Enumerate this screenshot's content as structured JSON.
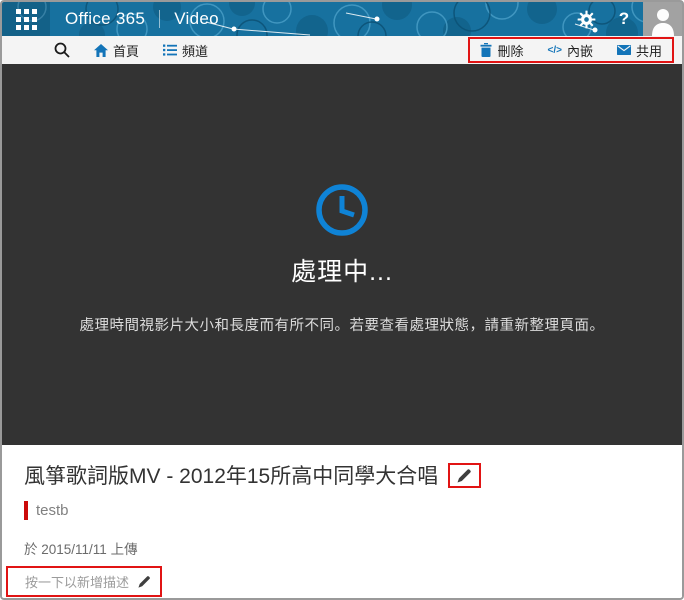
{
  "header": {
    "brand": "Office 365",
    "app_name": "Video",
    "help_label": "?",
    "icons": {
      "app_launcher": "waffle-grid",
      "settings": "gear",
      "account": "person-silhouette"
    }
  },
  "toolbar": {
    "search_icon": "magnifier",
    "nav": [
      {
        "label": "首頁",
        "icon": "home-icon"
      },
      {
        "label": "頻道",
        "icon": "channels-list-icon"
      }
    ],
    "actions": [
      {
        "label": "刪除",
        "icon": "trash-icon"
      },
      {
        "label": "內嵌",
        "icon": "code-icon",
        "glyph": "</>"
      },
      {
        "label": "共用",
        "icon": "envelope-icon"
      }
    ]
  },
  "stage": {
    "icon": "clock-icon",
    "status_title": "處理中...",
    "status_message": "處理時間視影片大小和長度而有所不同。若要查看處理狀態，請重新整理頁面。"
  },
  "video": {
    "title": "風箏歌詞版MV - 2012年15所高中同學大合唱",
    "uploader": "testb",
    "upload_info": "於 2015/11/11 上傳",
    "description_placeholder": "按一下以新增描述"
  },
  "colors": {
    "header_blue": "#17719f",
    "accent_blue": "#1374b8",
    "clock_blue": "#0f83d6",
    "stage_background": "#333333",
    "annotation_red": "#e11414",
    "avatar_tile_gray": "#a2a2a2"
  }
}
